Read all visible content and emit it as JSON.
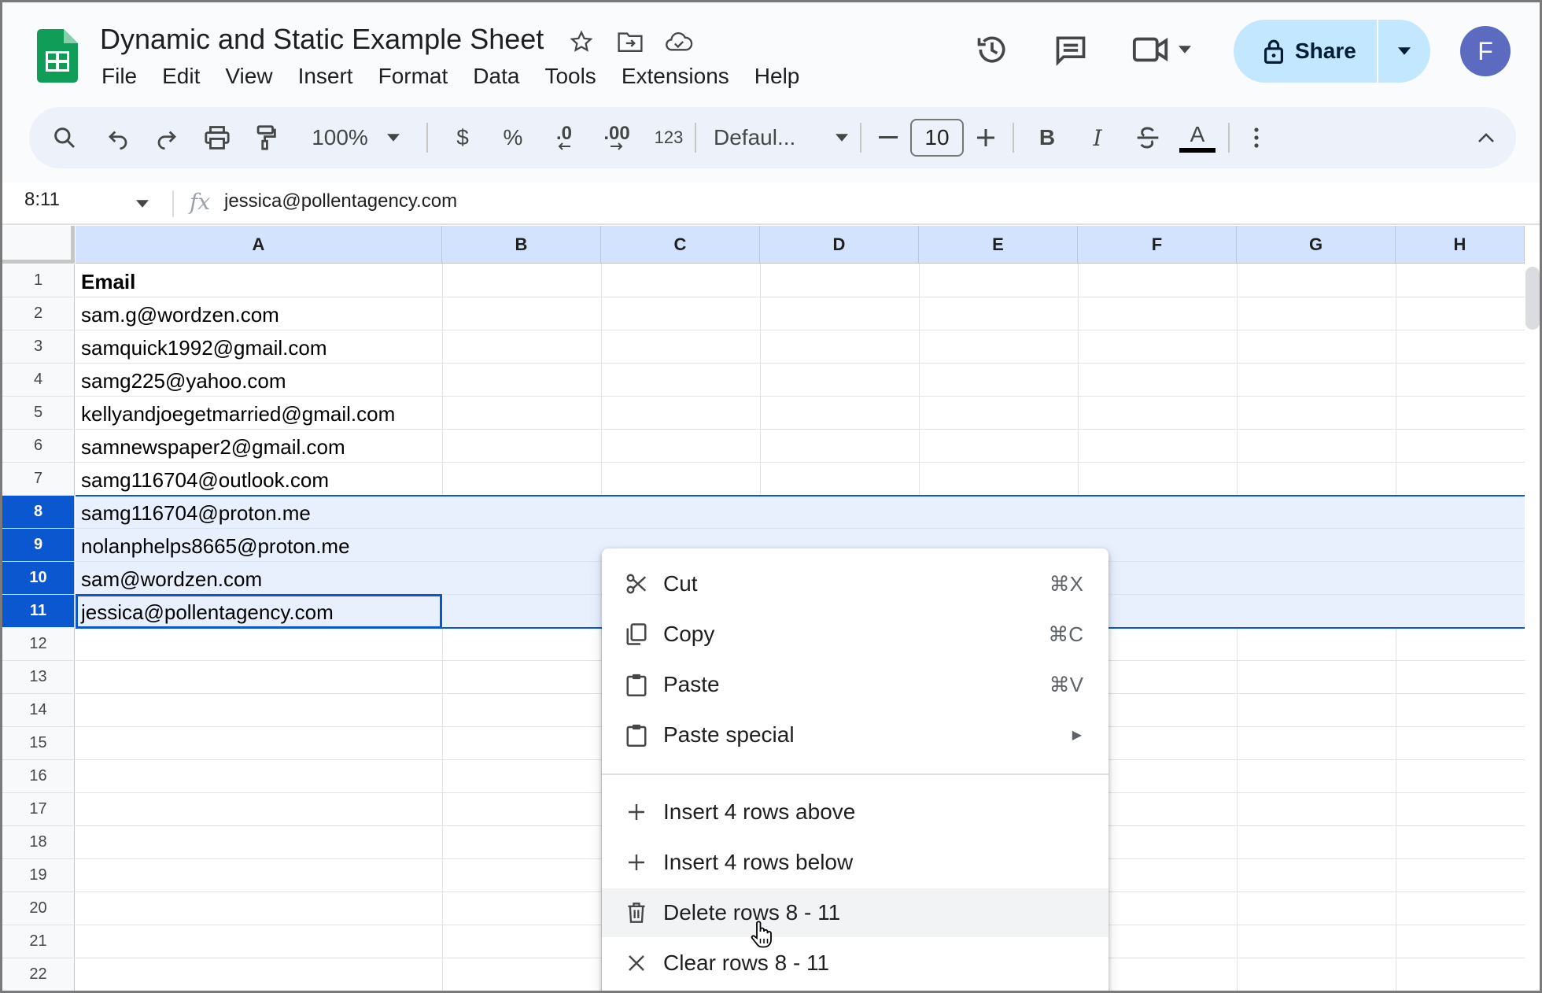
{
  "app": {
    "title": "Dynamic and Static Example Sheet",
    "menu": [
      "File",
      "Edit",
      "View",
      "Insert",
      "Format",
      "Data",
      "Tools",
      "Extensions",
      "Help"
    ],
    "share_label": "Share",
    "avatar_letter": "F",
    "brand_color": "#0f9d58",
    "accent_color": "#0b57d0"
  },
  "toolbar": {
    "zoom": "100%",
    "currency": "$",
    "percent": "%",
    "decrease_decimal": ".0",
    "increase_decimal": ".00",
    "number_format": "123",
    "font": "Defaul...",
    "font_size": "10",
    "bold": "B",
    "italic": "I",
    "text_color": "A",
    "icons": [
      "search-icon",
      "undo-icon",
      "redo-icon",
      "print-icon",
      "paint-format-icon",
      "strikethrough-icon",
      "more-vert-icon",
      "collapse-icon"
    ]
  },
  "formula_bar": {
    "name_box": "8:11",
    "fx": "fx",
    "value": "jessica@pollentagency.com"
  },
  "columns": [
    "A",
    "B",
    "C",
    "D",
    "E",
    "F",
    "G",
    "H"
  ],
  "rows": [
    {
      "num": "1",
      "a": "Email",
      "bold": true
    },
    {
      "num": "2",
      "a": "sam.g@wordzen.com"
    },
    {
      "num": "3",
      "a": "samquick1992@gmail.com"
    },
    {
      "num": "4",
      "a": "samg225@yahoo.com"
    },
    {
      "num": "5",
      "a": "kellyandjoegetmarried@gmail.com"
    },
    {
      "num": "6",
      "a": "samnewspaper2@gmail.com"
    },
    {
      "num": "7",
      "a": "samg116704@outlook.com"
    },
    {
      "num": "8",
      "a": "samg116704@proton.me",
      "selected": true
    },
    {
      "num": "9",
      "a": "nolanphelps8665@proton.me",
      "selected": true
    },
    {
      "num": "10",
      "a": "sam@wordzen.com",
      "selected": true
    },
    {
      "num": "11",
      "a": "jessica@pollentagency.com",
      "selected": true
    },
    {
      "num": "12",
      "a": ""
    },
    {
      "num": "13",
      "a": ""
    },
    {
      "num": "14",
      "a": ""
    },
    {
      "num": "15",
      "a": ""
    },
    {
      "num": "16",
      "a": ""
    },
    {
      "num": "17",
      "a": ""
    },
    {
      "num": "18",
      "a": ""
    },
    {
      "num": "19",
      "a": ""
    },
    {
      "num": "20",
      "a": ""
    },
    {
      "num": "21",
      "a": ""
    },
    {
      "num": "22",
      "a": ""
    }
  ],
  "context_menu": {
    "items": [
      {
        "label": "Cut",
        "shortcut": "⌘X",
        "icon": "scissors-icon"
      },
      {
        "label": "Copy",
        "shortcut": "⌘C",
        "icon": "copy-icon"
      },
      {
        "label": "Paste",
        "shortcut": "⌘V",
        "icon": "paste-icon"
      },
      {
        "label": "Paste special",
        "submenu": "▶",
        "icon": "paste-icon"
      },
      {
        "label": "Insert 4 rows above",
        "icon": "plus-icon"
      },
      {
        "label": "Insert 4 rows below",
        "icon": "plus-icon"
      },
      {
        "label": "Delete rows 8 - 11",
        "icon": "trash-icon",
        "hovered": true
      },
      {
        "label": "Clear rows 8 - 11",
        "icon": "close-icon"
      }
    ]
  }
}
